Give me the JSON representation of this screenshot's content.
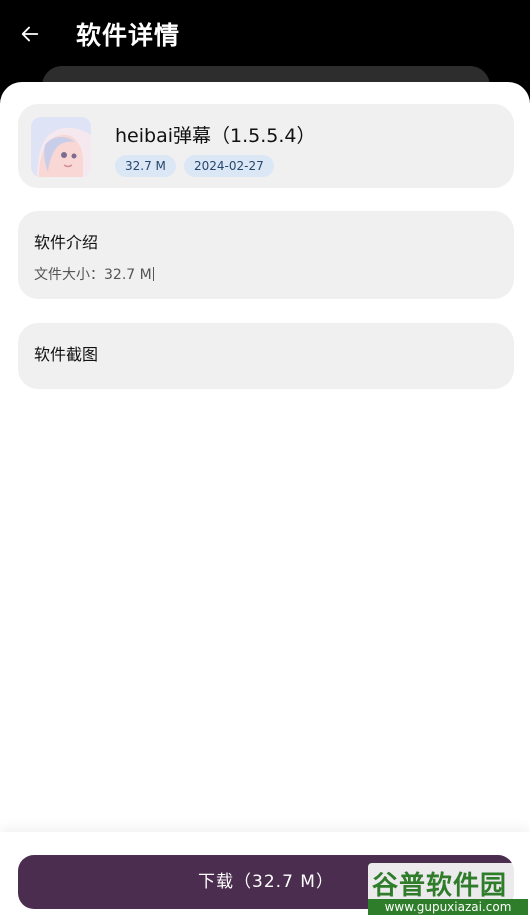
{
  "header": {
    "title": "软件详情",
    "back_icon": "arrow-left-icon"
  },
  "app": {
    "name": "heibai弹幕（1.5.5.4）",
    "size": "32.7 M",
    "date": "2024-02-27",
    "icon": "anime-character-app-icon"
  },
  "intro": {
    "title": "软件介绍",
    "text": "文件大小：32.7 M"
  },
  "screenshots": {
    "title": "软件截图"
  },
  "download": {
    "label": "下载（32.7 M）"
  },
  "watermark": {
    "brand": "谷普软件园",
    "url": "www.gupuxiazai.com"
  },
  "colors": {
    "header_bg": "#000000",
    "card_bg": "#f0f0f0",
    "tag_bg": "#dbe7f5",
    "button_bg": "#4b2e4f",
    "watermark_green": "#2e7d2a"
  }
}
